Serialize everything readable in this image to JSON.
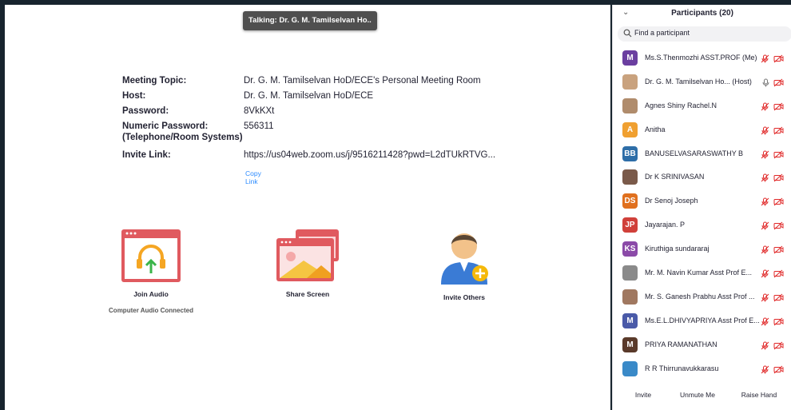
{
  "talking": "Talking: Dr. G. M. Tamilselvan Ho..",
  "meeting": {
    "topic_label": "Meeting Topic:",
    "topic": "Dr. G. M. Tamilselvan HoD/ECE's Personal Meeting Room",
    "host_label": "Host:",
    "host": "Dr. G. M. Tamilselvan HoD/ECE",
    "password_label": "Password:",
    "password": "8VkKXt",
    "numeric_label_1": "Numeric Password:",
    "numeric_label_2": "(Telephone/Room Systems)",
    "numeric": "556311",
    "invite_label": "Invite Link:",
    "invite": "https://us04web.zoom.us/j/9516211428?pwd=L2dTUkRTVG...",
    "copy_link": "Copy Link"
  },
  "actions": {
    "join_audio": "Join Audio",
    "computer_audio": "Computer Audio Connected",
    "share_screen": "Share Screen",
    "invite_others": "Invite Others"
  },
  "panel": {
    "title": "Participants (20)",
    "search_placeholder": "Find a participant",
    "participants": [
      {
        "name": "Ms.S.Thenmozhi ASST.PROF (Me)",
        "initials": "M",
        "color": "#6b3fa0",
        "mic": "muted"
      },
      {
        "name": "Dr. G. M. Tamilselvan Ho...  (Host)",
        "initials": "",
        "color": "#c9a27e",
        "mic": "on"
      },
      {
        "name": "Agnes Shiny Rachel.N",
        "initials": "",
        "color": "#b08c6c",
        "mic": "muted"
      },
      {
        "name": "Anitha",
        "initials": "A",
        "color": "#f0a030",
        "mic": "muted"
      },
      {
        "name": "BANUSELVASARASWATHY B",
        "initials": "BB",
        "color": "#2e6ea8",
        "mic": "muted"
      },
      {
        "name": "Dr K SRINIVASAN",
        "initials": "",
        "color": "#7a5a4a",
        "mic": "muted"
      },
      {
        "name": "Dr Senoj Joseph",
        "initials": "DS",
        "color": "#e0701e",
        "mic": "muted"
      },
      {
        "name": "Jayarajan. P",
        "initials": "JP",
        "color": "#d0403a",
        "mic": "muted"
      },
      {
        "name": "Kiruthiga sundararaj",
        "initials": "KS",
        "color": "#8b4aa8",
        "mic": "muted"
      },
      {
        "name": "Mr. M. Navin Kumar Asst Prof E...",
        "initials": "",
        "color": "#8a8a8a",
        "mic": "muted"
      },
      {
        "name": "Mr. S. Ganesh Prabhu Asst Prof ...",
        "initials": "",
        "color": "#a07860",
        "mic": "muted"
      },
      {
        "name": "Ms.E.L.DHIVYAPRIYA Asst Prof E...",
        "initials": "M",
        "color": "#4a5aa8",
        "mic": "muted"
      },
      {
        "name": "PRIYA RAMANATHAN",
        "initials": "M",
        "color": "#5a3a2a",
        "mic": "muted"
      },
      {
        "name": "R R Thirrunavukkarasu",
        "initials": "",
        "color": "#3a8ac8",
        "mic": "muted"
      }
    ],
    "invite": "Invite",
    "unmute": "Unmute Me",
    "raise_hand": "Raise Hand"
  },
  "colors": {
    "accent": "#2d8cff",
    "muted_red": "#e02828"
  }
}
